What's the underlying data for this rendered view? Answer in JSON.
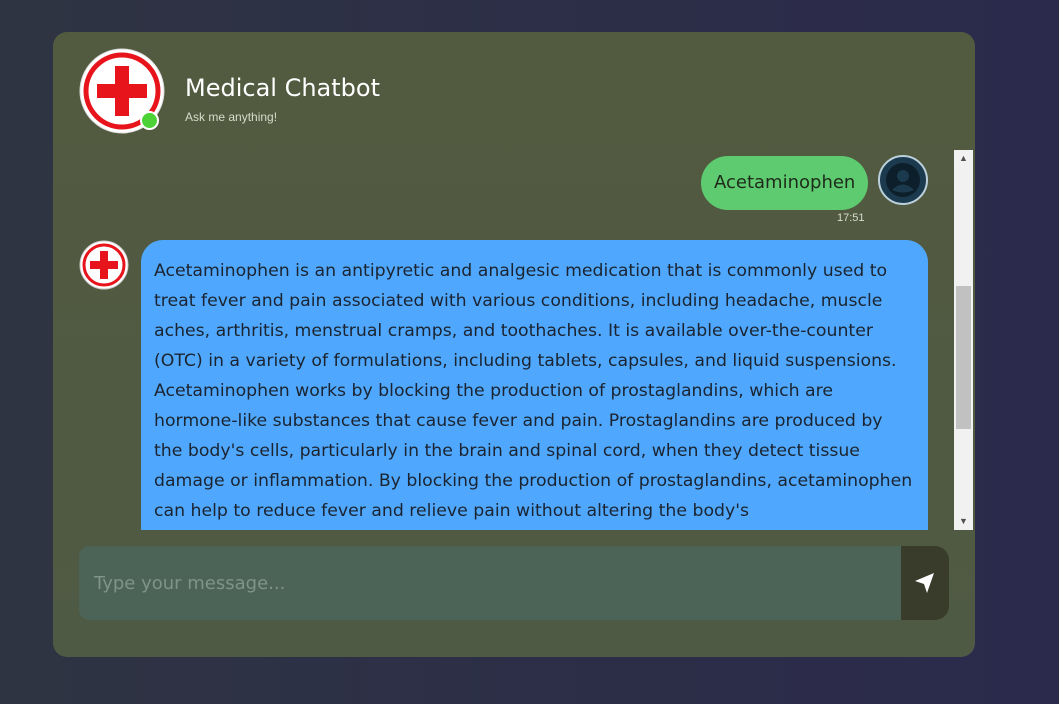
{
  "header": {
    "title": "Medical Chatbot",
    "subtitle": "Ask me anything!",
    "online_color": "#4cd137"
  },
  "messages": [
    {
      "sender": "user",
      "text": "Acetaminophen",
      "time": "17:51",
      "bubble_color": "#5fcb70",
      "avatar_icon": "user-icon"
    },
    {
      "sender": "bot",
      "avatar_icon": "medical-cross-icon",
      "bubble_color": "#4fa8fe",
      "text": "Acetaminophen is an antipyretic and analgesic medication that is commonly used to treat fever and pain associated with various conditions, including headache, muscle aches, arthritis, menstrual cramps, and toothaches. It is available over-the-counter (OTC) in a variety of formulations, including tablets, capsules, and liquid suspensions. Acetaminophen works by blocking the production of prostaglandins, which are hormone-like substances that cause fever and pain. Prostaglandins are produced by the body's cells, particularly in the brain and spinal cord, when they detect tissue damage or inflammation. By blocking the production of prostaglandins, acetaminophen can help to reduce fever and relieve pain without altering the body's"
    }
  ],
  "composer": {
    "placeholder": "Type your message...",
    "send_icon": "send-icon"
  }
}
